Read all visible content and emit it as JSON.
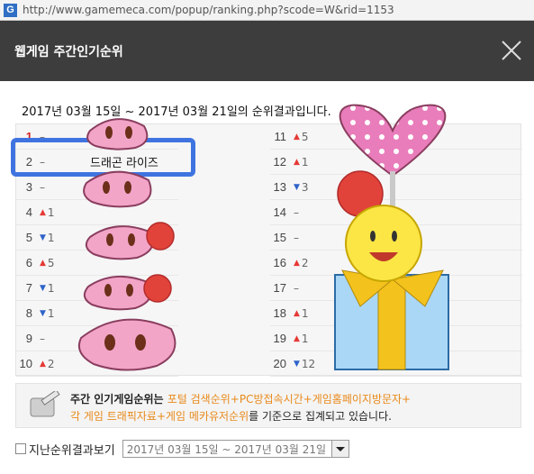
{
  "browser": {
    "url": "http://www.gamemeca.com/popup/ranking.php?scode=W&rid=1153",
    "site_icon": "G"
  },
  "popup": {
    "title": "웹게임 주간인기순위"
  },
  "period_text": "2017년 03월  15일 ~ 2017년 03월 21일의 순위결과입니다.",
  "rankings_left": [
    {
      "rank": "1",
      "change": "–",
      "dir": "none"
    },
    {
      "rank": "2",
      "change": "–",
      "dir": "none",
      "name": "드래곤 라이즈"
    },
    {
      "rank": "3",
      "change": "–",
      "dir": "none"
    },
    {
      "rank": "4",
      "change": "1",
      "dir": "up"
    },
    {
      "rank": "5",
      "change": "1",
      "dir": "down"
    },
    {
      "rank": "6",
      "change": "5",
      "dir": "up"
    },
    {
      "rank": "7",
      "change": "1",
      "dir": "down"
    },
    {
      "rank": "8",
      "change": "1",
      "dir": "down"
    },
    {
      "rank": "9",
      "change": "–",
      "dir": "none"
    },
    {
      "rank": "10",
      "change": "2",
      "dir": "up"
    }
  ],
  "rankings_right": [
    {
      "rank": "11",
      "change": "5",
      "dir": "up"
    },
    {
      "rank": "12",
      "change": "1",
      "dir": "up"
    },
    {
      "rank": "13",
      "change": "3",
      "dir": "down"
    },
    {
      "rank": "14",
      "change": "–",
      "dir": "none"
    },
    {
      "rank": "15",
      "change": "–",
      "dir": "none"
    },
    {
      "rank": "16",
      "change": "2",
      "dir": "up"
    },
    {
      "rank": "17",
      "change": "–",
      "dir": "none"
    },
    {
      "rank": "18",
      "change": "1",
      "dir": "up"
    },
    {
      "rank": "19",
      "change": "1",
      "dir": "up"
    },
    {
      "rank": "20",
      "change": "12",
      "dir": "down"
    }
  ],
  "info": {
    "line1_prefix": "주간 인기게임순위는 ",
    "line1_highlight": "포털 검색순위+PC방접속시간+게임홈페이지방문자+",
    "line2_highlight": "각 게임 트래픽자료+게임 메카유저순위",
    "line2_suffix": "를 기준으로 집계되고 있습니다."
  },
  "past_results": {
    "label": "지난순위결과보기",
    "selected": "2017년 03월 15일 ~ 2017년 03월 21일"
  },
  "colors": {
    "header_bg": "#3d3d3d",
    "highlight_border": "#3f74e0",
    "up": "#e53935",
    "down": "#2e63c9",
    "orange": "#e8891a"
  }
}
